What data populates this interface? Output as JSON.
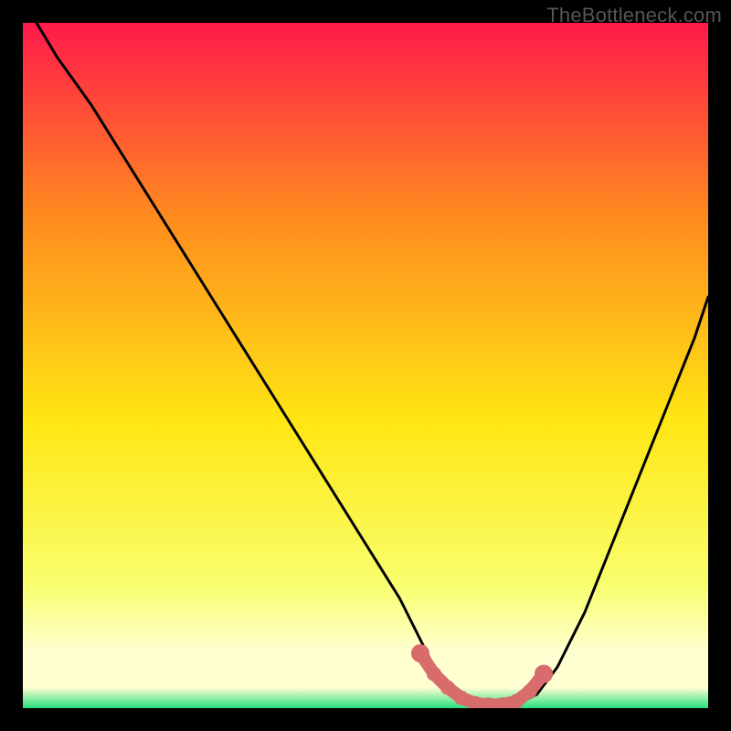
{
  "watermark": "TheBottleneck.com",
  "colors": {
    "background": "#000000",
    "gradient_top": "#ff1a4b",
    "gradient_mid_upper": "#ff8a1f",
    "gradient_mid": "#ffe613",
    "gradient_mid_lower": "#f8ff6e",
    "gradient_pale": "#ffffd2",
    "gradient_green": "#27e07d",
    "curve": "#000000",
    "marker_fill": "#d86b6b",
    "marker_stroke": "#d86b6b"
  },
  "chart_data": {
    "type": "line",
    "title": "",
    "xlabel": "",
    "ylabel": "",
    "xlim": [
      0,
      100
    ],
    "ylim": [
      0,
      100
    ],
    "series": [
      {
        "name": "bottleneck-curve",
        "x": [
          0,
          2,
          5,
          10,
          15,
          20,
          25,
          30,
          35,
          40,
          45,
          50,
          55,
          58,
          60,
          62,
          64,
          66,
          68,
          70,
          72,
          75,
          78,
          82,
          86,
          90,
          94,
          98,
          100
        ],
        "y": [
          110,
          100,
          95,
          88,
          80,
          72,
          64,
          56,
          48,
          40,
          32,
          24,
          16,
          10,
          6,
          3,
          1.2,
          0.5,
          0.3,
          0.3,
          0.6,
          2,
          6,
          14,
          24,
          34,
          44,
          54,
          60
        ]
      }
    ],
    "markers": {
      "name": "highlight-band",
      "x": [
        58,
        60,
        62,
        64,
        66,
        68,
        70,
        72,
        74,
        76
      ],
      "y": [
        8,
        5,
        3,
        1.5,
        0.7,
        0.5,
        0.5,
        1,
        2.5,
        5
      ]
    }
  }
}
